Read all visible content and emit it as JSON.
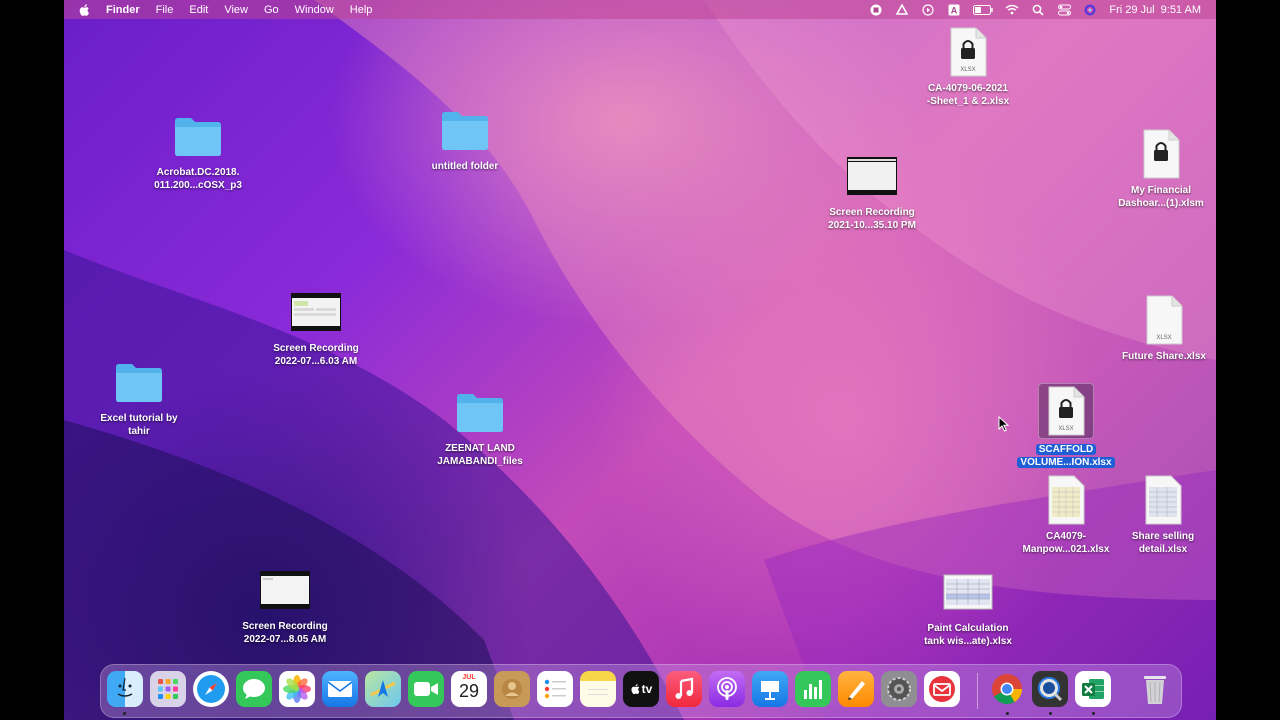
{
  "menubar": {
    "app_name": "Finder",
    "menus": [
      "File",
      "Edit",
      "View",
      "Go",
      "Window",
      "Help"
    ],
    "status_icons": [
      "screen-record-stop-icon",
      "drive-icon",
      "play-icon",
      "text-input-icon",
      "battery-icon",
      "wifi-icon",
      "search-icon",
      "control-center-icon",
      "siri-icon"
    ],
    "date": "Fri 29 Jul",
    "time": "9:51 AM"
  },
  "desktop": {
    "items": [
      {
        "label1": "Acrobat.DC.2018.",
        "label2": "011.200...cOSX_p3",
        "kind": "folder"
      },
      {
        "label1": "untitled folder",
        "label2": "",
        "kind": "folder"
      },
      {
        "label1": "CA-4079-06-2021",
        "label2": "-Sheet_1 & 2.xlsx",
        "kind": "locked-xlsx"
      },
      {
        "label1": "My Financial",
        "label2": "Dashoar...(1).xlsm",
        "kind": "locked-xlsx"
      },
      {
        "label1": "Screen Recording",
        "label2": "2021-10...35.10 PM",
        "kind": "video"
      },
      {
        "label1": "Screen Recording",
        "label2": "2022-07...6.03 AM",
        "kind": "video"
      },
      {
        "label1": "Future Share.xlsx",
        "label2": "",
        "kind": "xlsx"
      },
      {
        "label1": "Excel tutorial by",
        "label2": "tahir",
        "kind": "folder"
      },
      {
        "label1": "ZEENAT LAND",
        "label2": "JAMABANDI_files",
        "kind": "folder"
      },
      {
        "label1": "SCAFFOLD",
        "label2": "VOLUME...ION.xlsx",
        "kind": "locked-xlsx",
        "selected": true
      },
      {
        "label1": "CA4079-",
        "label2": "Manpow...021.xlsx",
        "kind": "xlsx-preview"
      },
      {
        "label1": "Share selling",
        "label2": "detail.xlsx",
        "kind": "xlsx-preview"
      },
      {
        "label1": "Screen Recording",
        "label2": "2022-07...8.05 AM",
        "kind": "video"
      },
      {
        "label1": "Paint  Calculation",
        "label2": "tank wis...ate).xlsx",
        "kind": "xlsx-preview"
      }
    ],
    "file_badge": "XLSX"
  },
  "dock": {
    "apps": [
      "Finder",
      "Launchpad",
      "Safari",
      "Messages",
      "Photos",
      "Mail",
      "Maps",
      "FaceTime",
      "Calendar",
      "Contacts",
      "Reminders",
      "Notes",
      "TV",
      "Music",
      "Podcasts",
      "Keynote",
      "Numbers",
      "Pages",
      "System Preferences",
      "Mail Client",
      "Chrome",
      "QuickTime Player",
      "Excel",
      "Trash"
    ],
    "calendar_month": "JUL",
    "calendar_day": "29",
    "tv_label": "tv"
  }
}
